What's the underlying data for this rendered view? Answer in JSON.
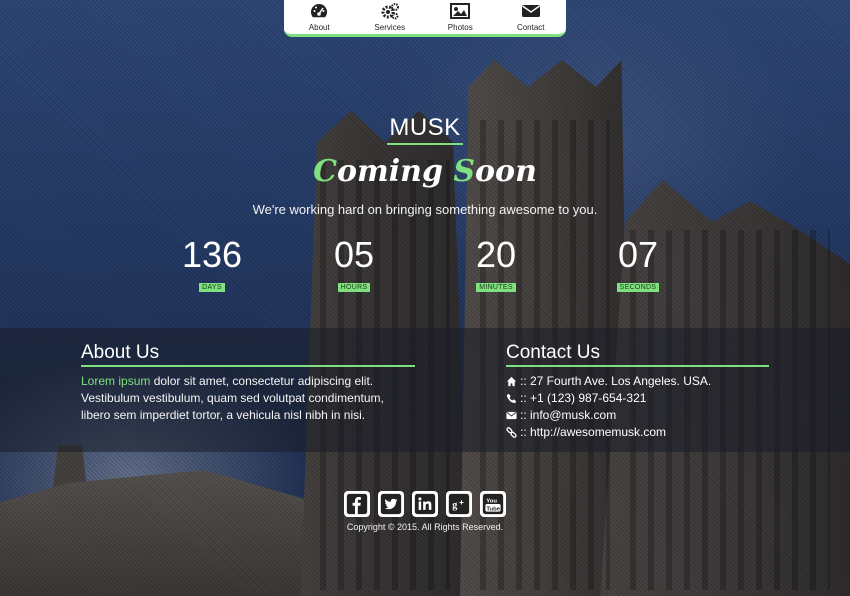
{
  "nav": [
    {
      "label": "About",
      "icon": "dashboard-icon"
    },
    {
      "label": "Services",
      "icon": "gears-icon"
    },
    {
      "label": "Photos",
      "icon": "picture-icon"
    },
    {
      "label": "Contact",
      "icon": "envelope-icon"
    }
  ],
  "brand": "MUSK",
  "heading": {
    "part1_initial": "C",
    "part1_rest": "oming ",
    "part2_initial": "S",
    "part2_rest": "oon"
  },
  "tagline": "We're working hard on bringing something awesome to you.",
  "countdown": [
    {
      "value": "136",
      "label": "DAYS"
    },
    {
      "value": "05",
      "label": "HOURS"
    },
    {
      "value": "20",
      "label": "MINUTES"
    },
    {
      "value": "07",
      "label": "SECONDS"
    }
  ],
  "about": {
    "title": "About Us",
    "highlight": "Lorem ipsum",
    "text": " dolor sit amet, consectetur adipiscing elit. Vestibulum vestibulum, quam sed volutpat condimentum, libero sem imperdiet tortor, a vehicula nisl nibh in nisi."
  },
  "contact": {
    "title": "Contact Us",
    "rows": [
      {
        "icon": "home-icon",
        "text": ":: 27 Fourth Ave. Los Angeles. USA."
      },
      {
        "icon": "phone-icon",
        "text": ":: +1 (123) 987-654-321"
      },
      {
        "icon": "envelope-icon",
        "text": ":: info@musk.com"
      },
      {
        "icon": "link-icon",
        "text": ":: http://awesomemusk.com"
      }
    ]
  },
  "social": [
    "facebook-icon",
    "twitter-icon",
    "linkedin-icon",
    "google-plus-icon",
    "youtube-icon"
  ],
  "copyright": "Copyright © 2015. All Rights Reserved.",
  "colors": {
    "accent": "#7ee07e",
    "nav_bg": "#ffffff"
  }
}
